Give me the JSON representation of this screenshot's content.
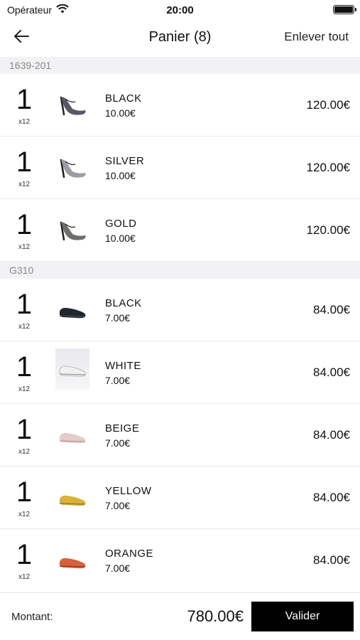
{
  "status_bar": {
    "carrier": "Opérateur",
    "time": "20:00"
  },
  "nav": {
    "title": "Panier (8)",
    "clear_all": "Enlever tout"
  },
  "sections": [
    {
      "header": "1639-201",
      "items": [
        {
          "qty": "1",
          "pack": "x12",
          "color": "BLACK",
          "unit_price": "10.00€",
          "total": "120.00€",
          "shoe": "heel",
          "shoe_color": "#555a66"
        },
        {
          "qty": "1",
          "pack": "x12",
          "color": "SILVER",
          "unit_price": "10.00€",
          "total": "120.00€",
          "shoe": "heel",
          "shoe_color": "#9c9ca4"
        },
        {
          "qty": "1",
          "pack": "x12",
          "color": "GOLD",
          "unit_price": "10.00€",
          "total": "120.00€",
          "shoe": "heel",
          "shoe_color": "#6f6d69"
        }
      ]
    },
    {
      "header": "G310",
      "items": [
        {
          "qty": "1",
          "pack": "x12",
          "color": "BLACK",
          "unit_price": "7.00€",
          "total": "84.00€",
          "shoe": "loafer",
          "shoe_color": "#1f2630"
        },
        {
          "qty": "1",
          "pack": "x12",
          "color": "WHITE",
          "unit_price": "7.00€",
          "total": "84.00€",
          "shoe": "loafer",
          "shoe_color": "#f1f1f1"
        },
        {
          "qty": "1",
          "pack": "x12",
          "color": "BEIGE",
          "unit_price": "7.00€",
          "total": "84.00€",
          "shoe": "loafer",
          "shoe_color": "#e3cdc8"
        },
        {
          "qty": "1",
          "pack": "x12",
          "color": "YELLOW",
          "unit_price": "7.00€",
          "total": "84.00€",
          "shoe": "loafer",
          "shoe_color": "#d8b23a"
        },
        {
          "qty": "1",
          "pack": "x12",
          "color": "ORANGE",
          "unit_price": "7.00€",
          "total": "84.00€",
          "shoe": "loafer",
          "shoe_color": "#d9603a"
        }
      ]
    }
  ],
  "footer": {
    "amount_label": "Montant:",
    "amount_value": "780.00€",
    "validate_label": "Valider"
  }
}
